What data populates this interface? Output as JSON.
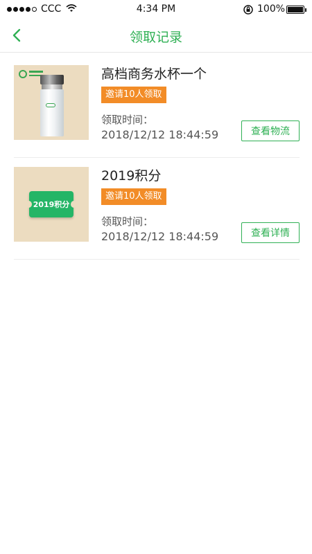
{
  "status_bar": {
    "carrier": "CCC",
    "time": "4:34 PM",
    "battery": "100%",
    "icons": [
      "signal-icon",
      "wifi-icon",
      "rotation-lock-icon",
      "battery-icon"
    ]
  },
  "nav": {
    "title": "领取记录",
    "back_icon": "chevron-left-icon"
  },
  "records": [
    {
      "title": "高档商务水杯一个",
      "badge": "邀请10人领取",
      "time_label": "领取时间：",
      "time": "2018/12/12 18:44:59",
      "action": "查看物流",
      "image": "water-bottle-image"
    },
    {
      "title": "2019积分",
      "badge": "邀请10人领取",
      "time_label": "领取时间：",
      "time": "2018/12/12 18:44:59",
      "action": "查看详情",
      "image": "points-ticket-image",
      "ticket_text": "2019积分"
    }
  ],
  "colors": {
    "accent_green": "#2fb054",
    "badge_orange": "#f28c27",
    "thumb_bg": "#ecdcc0"
  }
}
